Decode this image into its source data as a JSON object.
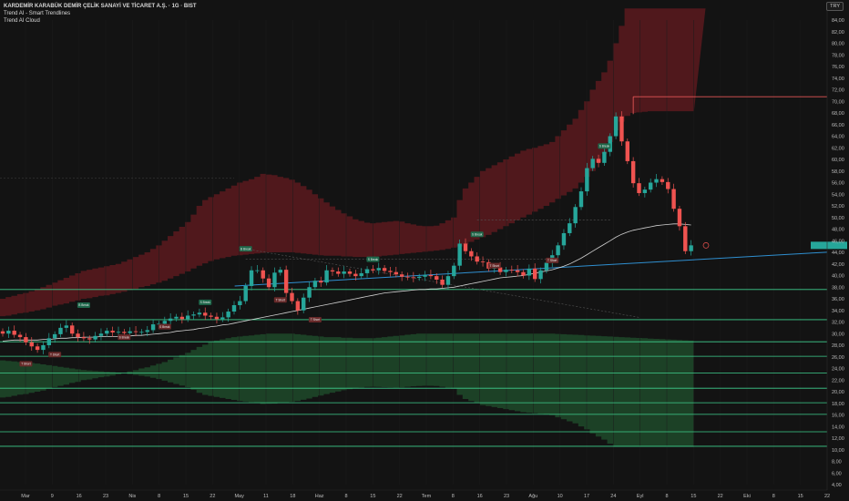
{
  "legend": {
    "title": "KARDEMİR KARABÜK DEMİR ÇELİK SANAYİ VE TİCARET A.Ş. · 1G · BIST",
    "indicators": [
      "Trend AI - Smart Trendlines",
      "Trend AI Cloud"
    ]
  },
  "currency": "TRY",
  "colors": {
    "bull": "#26a69a",
    "bear": "#ef5350",
    "cloud_red": "#5c1a1f",
    "cloud_green": "#1f4a2a",
    "support": "#3ecf8e",
    "trend": "#2f8fd0",
    "resistance": "#e35555",
    "ma": "#e6e6e6"
  },
  "chart_data": {
    "type": "candlestick",
    "ylim": [
      3,
      87
    ],
    "y_ticks": [
      4,
      6,
      8,
      10,
      12,
      14,
      16,
      18,
      20,
      22,
      24,
      26,
      28,
      30,
      32,
      34,
      36,
      38,
      40,
      42,
      44,
      46,
      48,
      50,
      52,
      54,
      56,
      58,
      60,
      62,
      64,
      66,
      68,
      70,
      72,
      74,
      76,
      78,
      80,
      82,
      84
    ],
    "x_ticks": [
      "Mar",
      "9",
      "16",
      "23",
      "Nis",
      "8",
      "15",
      "22",
      "May",
      "11",
      "18",
      "Haz",
      "8",
      "15",
      "22",
      "Tem",
      "8",
      "16",
      "23",
      "Ağu",
      "10",
      "17",
      "24",
      "Eyl",
      "8",
      "15",
      "22",
      "Eki",
      "8",
      "15",
      "22"
    ],
    "close_series": [
      30,
      30.5,
      29.8,
      29.4,
      28.5,
      27.8,
      27.2,
      28,
      29.2,
      29.9,
      31,
      31.4,
      30,
      29.4,
      29.2,
      29,
      29.6,
      30,
      30.5,
      30.2,
      30.3,
      30.1,
      30.4,
      30.3,
      30.3,
      30.6,
      31.6,
      31.7,
      32.2,
      32.6,
      32.9,
      32.5,
      33.1,
      33.3,
      33.6,
      33.1,
      32.9,
      32.5,
      32.8,
      33.8,
      34.9,
      35.6,
      38.2,
      40.9,
      40.9,
      39.5,
      38,
      40.5,
      41,
      37,
      35.6,
      34,
      36.2,
      38,
      39.1,
      38.8,
      40.9,
      40.7,
      40.3,
      40.7,
      40.3,
      39.9,
      40.4,
      41.1,
      40.9,
      41.3,
      40.8,
      40.6,
      40.2,
      39.8,
      39.7,
      39.6,
      39.8,
      40.1,
      39.9,
      39.3,
      38.4,
      39.9,
      41.7,
      45.5,
      44.2,
      43.3,
      42.4,
      42.3,
      41.2,
      41.4,
      40.6,
      41,
      40.9,
      40.6,
      40,
      41.2,
      39.4,
      40.9,
      42.2,
      43.5,
      45.2,
      47.3,
      49,
      51.8,
      54.5,
      58.5,
      60.1,
      59.4,
      61.3,
      64,
      67.4,
      63.1,
      59.7,
      55.9,
      54.2,
      54.8,
      56,
      56.6,
      56.1,
      54.9,
      51.5,
      48.5,
      44.2,
      45.2
    ],
    "ma_series": [
      28.7,
      28.8,
      28.9,
      28.9,
      28.9,
      28.9,
      28.9,
      29,
      29,
      29.1,
      29.2,
      29.2,
      29.3,
      29.3,
      29.4,
      29.4,
      29.4,
      29.5,
      29.5,
      29.5,
      29.5,
      29.6,
      29.6,
      29.7,
      29.7,
      29.8,
      29.9,
      30,
      30.1,
      30.2,
      30.4,
      30.5,
      30.6,
      30.7,
      30.9,
      31,
      31.2,
      31.3,
      31.5,
      31.6,
      31.8,
      32,
      32.2,
      32.4,
      32.6,
      32.8,
      33,
      33.2,
      33.4,
      33.6,
      33.8,
      34,
      34.2,
      34.4,
      34.6,
      34.8,
      35,
      35.2,
      35.4,
      35.6,
      35.8,
      36,
      36.2,
      36.4,
      36.6,
      36.8,
      37,
      37.1,
      37.2,
      37.3,
      37.4,
      37.5,
      37.6,
      37.6,
      37.7,
      37.7,
      37.8,
      37.9,
      38,
      38.2,
      38.4,
      38.6,
      38.8,
      39,
      39.2,
      39.4,
      39.6,
      39.7,
      39.8,
      39.9,
      40,
      40.2,
      40.4,
      40.6,
      40.8,
      41,
      41.3,
      41.6,
      42,
      42.5,
      43,
      43.6,
      44.2,
      44.8,
      45.4,
      46,
      46.6,
      47.1,
      47.5,
      47.8,
      48,
      48.2,
      48.4,
      48.6,
      48.7,
      48.8,
      48.9,
      48.9,
      48.8,
      48.7
    ],
    "cloud_upper": [
      36,
      36.3,
      36.5,
      36.8,
      37,
      37.3,
      37.6,
      38,
      38.4,
      38.8,
      39.2,
      39.6,
      40,
      40.4,
      40.8,
      41,
      41.2,
      41.4,
      41.6,
      41.8,
      42,
      42.4,
      42.8,
      43.2,
      43.6,
      44,
      44.6,
      45.2,
      46,
      46.8,
      47.6,
      48.4,
      49.2,
      50.5,
      52,
      53,
      53.5,
      54,
      54.5,
      55,
      55.5,
      56,
      56.3,
      56.6,
      57,
      57.5,
      57.4,
      57.3,
      57,
      56.8,
      56.5,
      56,
      55.4,
      54.8,
      54,
      53.3,
      52.6,
      51.9,
      51.3,
      50.7,
      50.2,
      49.7,
      49.4,
      49.1,
      49,
      49.1,
      49.2,
      49.3,
      49.4,
      49.3,
      49,
      48.8,
      48.6,
      48.5,
      48.5,
      48.6,
      49,
      49.5,
      50,
      53,
      55,
      56,
      57,
      58,
      58.5,
      59,
      59.5,
      60,
      60.5,
      61,
      61.5,
      61.8,
      62,
      62.3,
      62.6,
      63,
      64,
      65,
      66,
      67,
      68.5,
      70,
      72,
      73.5,
      75,
      77,
      80,
      83,
      86,
      86,
      86,
      86,
      86,
      86,
      86,
      86,
      86,
      86,
      86,
      86,
      86,
      86
    ],
    "cloud_lower": [
      33,
      33.1,
      33.3,
      33.5,
      33.6,
      33.8,
      34,
      34.2,
      34.5,
      34.8,
      35,
      35.2,
      35.5,
      35.7,
      36,
      36.1,
      36.3,
      36.5,
      36.6,
      36.8,
      37,
      37.2,
      37.5,
      37.7,
      38,
      38.2,
      38.5,
      38.8,
      39.1,
      39.5,
      39.9,
      40.3,
      40.7,
      41.2,
      41.7,
      42.1,
      42.5,
      42.8,
      43,
      43.2,
      43.4,
      43.5,
      43.6,
      43.7,
      43.8,
      43.9,
      44,
      44,
      44,
      44,
      44,
      43.9,
      43.8,
      43.7,
      43.6,
      43.5,
      43.4,
      43.4,
      43.4,
      43.3,
      43.3,
      43.2,
      43.2,
      43.2,
      43.2,
      43.3,
      43.4,
      43.5,
      43.6,
      43.7,
      43.8,
      43.9,
      44,
      44.1,
      44.2,
      44.3,
      44.4,
      44.6,
      44.8,
      45,
      45.4,
      45.8,
      46.2,
      46.6,
      47,
      47.5,
      48,
      48.5,
      49,
      49.5,
      50,
      50.5,
      51,
      51.5,
      52,
      52.6,
      53.2,
      53.8,
      54.4,
      55,
      56,
      57,
      58,
      59.5,
      61,
      63,
      65,
      66.5,
      67.5,
      68,
      68.1,
      68.2,
      68.3,
      68.3,
      68.3,
      68.3,
      68.3,
      68.3,
      68.3,
      68.3
    ],
    "support_levels": [
      37.6,
      32.4,
      28.6,
      26.1,
      23.2,
      20.6,
      18.1,
      16.1,
      13.1,
      10.6
    ],
    "resistance_level": 70.8,
    "trendline": {
      "from": [
        40.1,
        38.2
      ],
      "to": [
        121,
        42.8
      ]
    },
    "signals": [
      {
        "i": 4,
        "label": "T Short",
        "side": "sell",
        "y": 24.8
      },
      {
        "i": 9,
        "label": "T Short",
        "side": "sell",
        "y": 26.4
      },
      {
        "i": 14,
        "label": "B Break",
        "side": "buy",
        "y": 34.9
      },
      {
        "i": 21,
        "label": "S Break",
        "side": "sell",
        "y": 29.4
      },
      {
        "i": 28,
        "label": "S Break",
        "side": "sell",
        "y": 31.2
      },
      {
        "i": 35,
        "label": "S Break",
        "side": "buy",
        "y": 35.4
      },
      {
        "i": 42,
        "label": "B Break",
        "side": "buy",
        "y": 44.6
      },
      {
        "i": 48,
        "label": "T Short",
        "side": "sell",
        "y": 35.8
      },
      {
        "i": 54,
        "label": "T Short",
        "side": "sell",
        "y": 32.4
      },
      {
        "i": 64,
        "label": "S Break",
        "side": "buy",
        "y": 42.8
      },
      {
        "i": 82,
        "label": "S Break",
        "side": "buy",
        "y": 47.1
      },
      {
        "i": 85,
        "label": "T Short",
        "side": "sell",
        "y": 41.7
      },
      {
        "i": 95,
        "label": "T Short",
        "side": "sell",
        "y": 42.6
      },
      {
        "i": 104,
        "label": "S Break",
        "side": "buy",
        "y": 62.3
      }
    ]
  }
}
